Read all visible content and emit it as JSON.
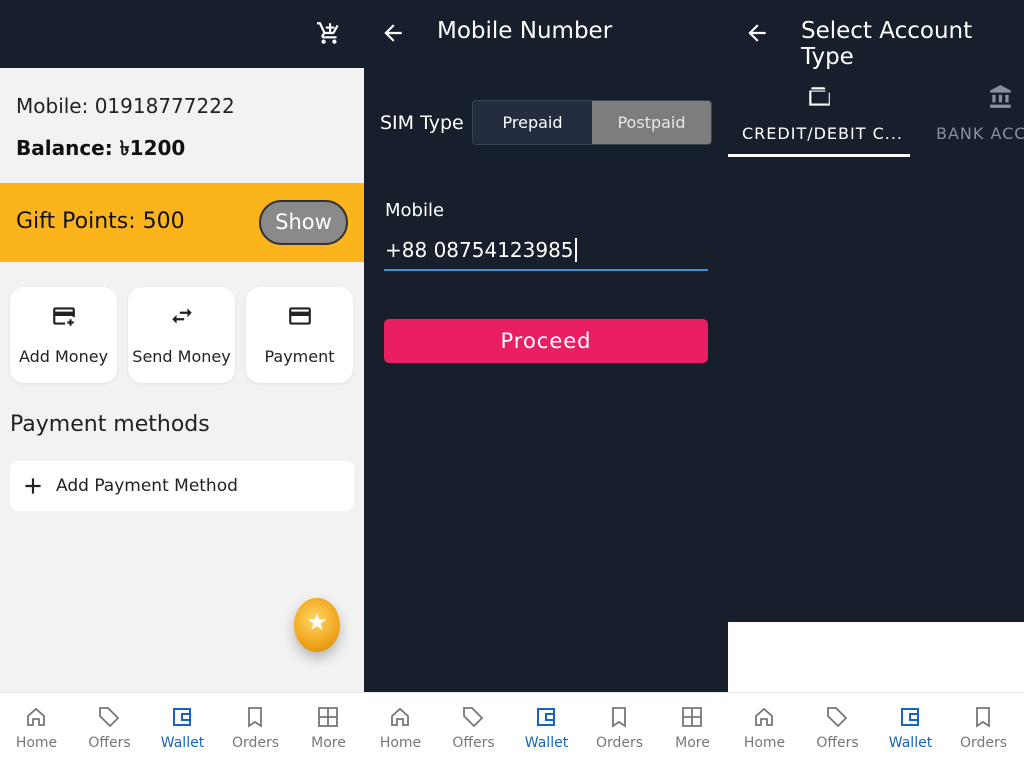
{
  "panel1": {
    "mobile": "Mobile: 01918777222",
    "balance": "Balance: ৳1200",
    "gift_points": "Gift Points: 500",
    "show_label": "Show",
    "actions": [
      {
        "label": "Add Money",
        "icon": "add-card-icon"
      },
      {
        "label": "Send Money",
        "icon": "swap-arrows-icon"
      },
      {
        "label": "Payment",
        "icon": "credit-card-icon"
      }
    ],
    "payment_methods_title": "Payment methods",
    "add_payment_method": "Add Payment Method"
  },
  "panel2": {
    "title": "Mobile Number",
    "sim_type_label": "SIM Type",
    "sim_options": [
      "Prepaid",
      "Postpaid"
    ],
    "sim_selected": "Prepaid",
    "mobile_label": "Mobile",
    "mobile_value": "+88 08754123985",
    "proceed_label": "Proceed"
  },
  "panel3": {
    "title": "Select Account Type",
    "tabs": [
      {
        "label": "CREDIT/DEBIT C...",
        "icon": "wallet-icon"
      },
      {
        "label": "BANK ACCO",
        "icon": "bank-icon"
      }
    ]
  },
  "nav": {
    "items": [
      "Home",
      "Offers",
      "Wallet",
      "Orders",
      "More"
    ],
    "active": "Wallet"
  },
  "colors": {
    "dark": "#171e2c",
    "gift_bar": "#fbb41b",
    "proceed": "#e91e63",
    "nav_active": "#1565c0",
    "input_underline": "#3b8fe3"
  }
}
